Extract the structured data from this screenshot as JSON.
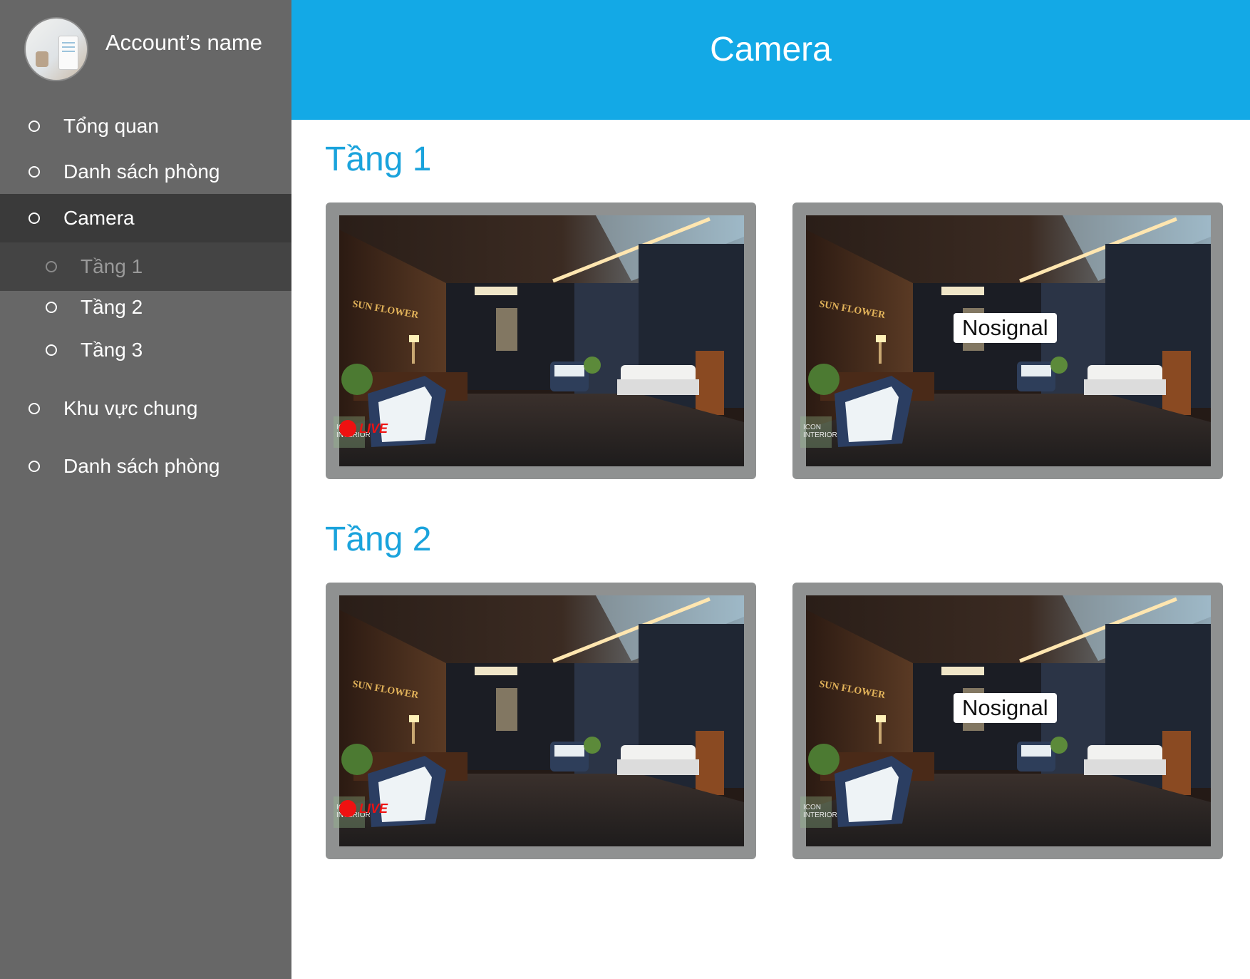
{
  "account": {
    "name": "Account’s name"
  },
  "header": {
    "title": "Camera"
  },
  "sidebar": {
    "items": [
      {
        "label": "Tổng quan"
      },
      {
        "label": "Danh sách phòng"
      },
      {
        "label": "Camera"
      },
      {
        "label": "Tầng 1"
      },
      {
        "label": "Tầng 2"
      },
      {
        "label": "Tầng 3"
      },
      {
        "label": "Khu vực chung"
      },
      {
        "label": "Danh sách phòng"
      }
    ]
  },
  "sections": [
    {
      "title": "Tầng 1",
      "cameras": [
        {
          "status": "live",
          "badge": "LIVE",
          "watermark": "ICON INTERIOR",
          "sign": "SUN FLOWER"
        },
        {
          "status": "nosignal",
          "overlay": "Nosignal",
          "watermark": "ICON INTERIOR",
          "sign": "SUN FLOWER"
        }
      ]
    },
    {
      "title": "Tầng 2",
      "cameras": [
        {
          "status": "live",
          "badge": "LIVE",
          "watermark": "ICON INTERIOR",
          "sign": "SUN FLOWER"
        },
        {
          "status": "nosignal",
          "overlay": "Nosignal",
          "watermark": "ICON INTERIOR",
          "sign": "SUN FLOWER"
        }
      ]
    }
  ],
  "colors": {
    "accent": "#13a9e6",
    "sidebar": "#676767",
    "active": "#3a3a3a",
    "live": "#ef1111"
  }
}
